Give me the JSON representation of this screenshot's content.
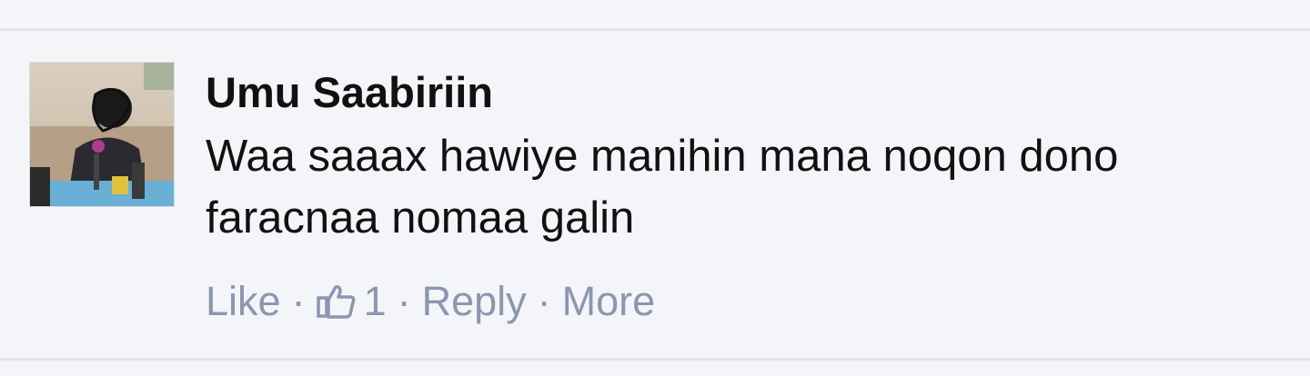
{
  "comment": {
    "author": "Umu Saabiriin",
    "text": "Waa saaax hawiye manihin mana noqon dono faracnaa nomaa galin",
    "actions": {
      "like_label": "Like",
      "separator": "·",
      "like_count": "1",
      "reply_label": "Reply",
      "more_label": "More"
    },
    "icons": {
      "like_count_icon": "thumbs-up-icon",
      "avatar": "user-photo"
    },
    "colors": {
      "background": "#f4f5f8",
      "action_text": "#8b97b1",
      "author_text": "#111111"
    }
  }
}
